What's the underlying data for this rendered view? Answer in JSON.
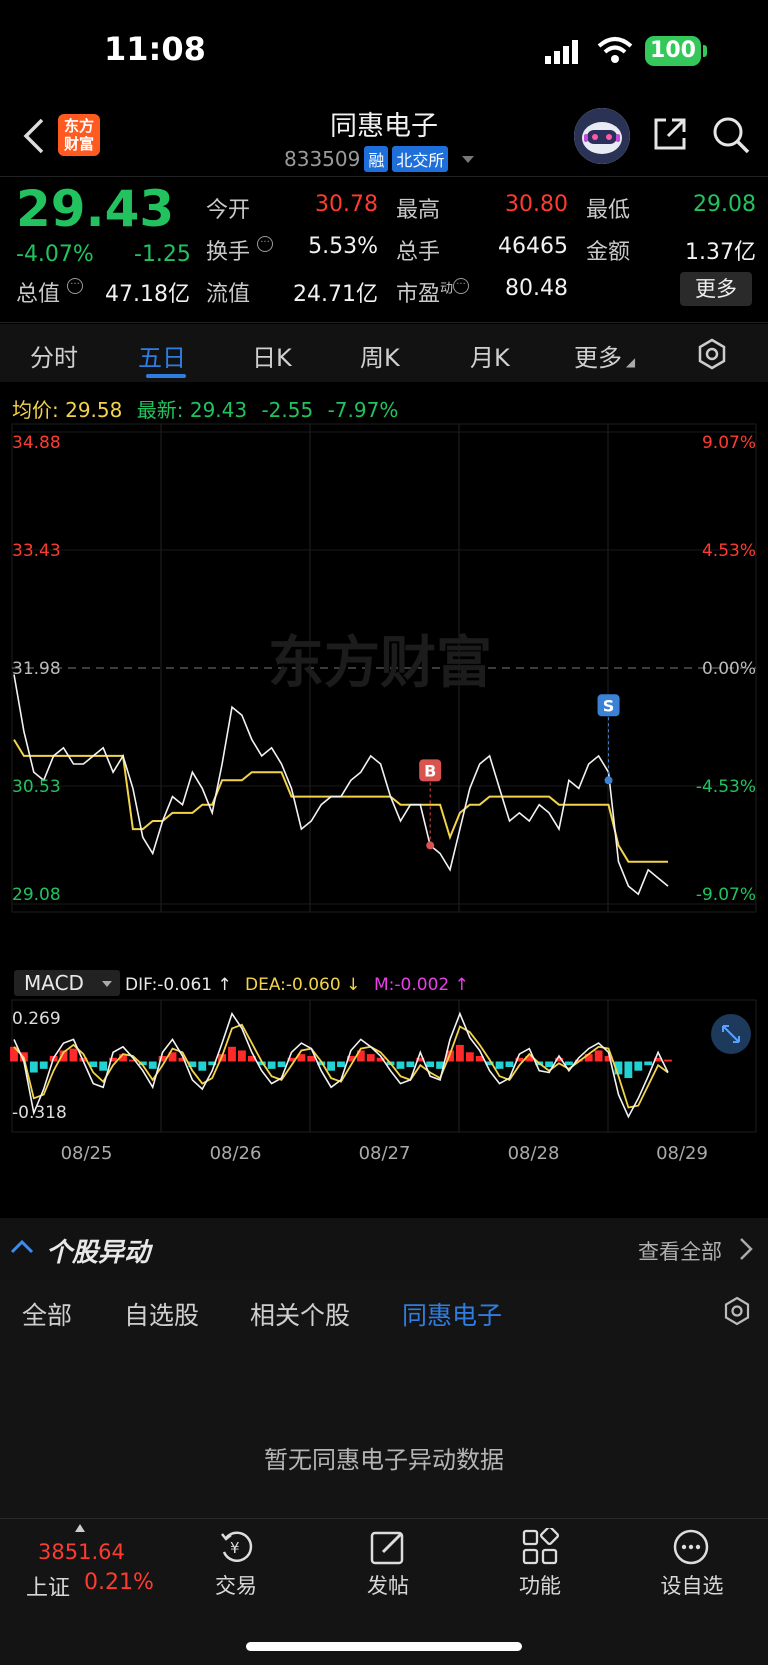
{
  "status": {
    "time": "11:08",
    "battery": "100"
  },
  "header": {
    "logo_line1": "东方",
    "logo_line2": "财富",
    "stock_name": "同惠电子",
    "stock_code": "833509",
    "tag_margin": "融",
    "tag_exchange": "北交所"
  },
  "quote": {
    "price": "29.43",
    "change_pct": "-4.07%",
    "change": "-1.25",
    "open_label": "今开",
    "open": "30.78",
    "high_label": "最高",
    "high": "30.80",
    "low_label": "最低",
    "low": "29.08",
    "turnover_label": "换手",
    "turnover": "5.53%",
    "volume_label": "总手",
    "volume": "46465",
    "amount_label": "金额",
    "amount": "1.37亿",
    "mktcap_label": "总值",
    "mktcap": "47.18亿",
    "float_label": "流值",
    "float_cap": "24.71亿",
    "pe_label": "市盈",
    "pe_super": "动",
    "pe": "80.48",
    "more_label": "更多"
  },
  "tabs": [
    {
      "label": "分时"
    },
    {
      "label": "五日"
    },
    {
      "label": "日K"
    },
    {
      "label": "周K"
    },
    {
      "label": "月K"
    },
    {
      "label": "更多"
    }
  ],
  "avgline": {
    "avg_label": "均价:",
    "avg": "29.58",
    "latest_label": "最新:",
    "latest": "29.43",
    "chg": "-2.55",
    "pct": "-7.97%"
  },
  "chart_data": {
    "type": "line",
    "price_axis_left": [
      "34.88",
      "33.43",
      "31.98",
      "30.53",
      "29.08"
    ],
    "price_axis_right": [
      "9.07%",
      "4.53%",
      "0.00%",
      "-4.53%",
      "-9.07%"
    ],
    "ylim": [
      29.08,
      34.88
    ],
    "reference_price": 31.98,
    "days": [
      "08/25",
      "08/26",
      "08/27",
      "08/28",
      "08/29"
    ],
    "series": [
      {
        "values": [
          31.9,
          31.2,
          30.7,
          30.6,
          30.9,
          31.0,
          30.8,
          30.8,
          30.9,
          31.0,
          30.7,
          30.9,
          30.5,
          29.9,
          29.7,
          30.1,
          30.4,
          30.3,
          30.7,
          30.5,
          30.2,
          30.8,
          31.5,
          31.4,
          31.1,
          30.9,
          31.0,
          30.8,
          30.5,
          30.0,
          30.1,
          30.3,
          30.4,
          30.4,
          30.6,
          30.7,
          30.9,
          30.8,
          30.4,
          30.1,
          30.3,
          30.3,
          29.8,
          29.7,
          29.5,
          30.0,
          30.5,
          30.8,
          30.9,
          30.5,
          30.1,
          30.2,
          30.1,
          30.3,
          30.2,
          30.0,
          30.6,
          30.5,
          30.8,
          30.9,
          30.7,
          29.6,
          29.3,
          29.2,
          29.5,
          29.4,
          29.3
        ]
      },
      {
        "values": [
          31.1,
          30.9,
          30.9,
          30.9,
          30.9,
          30.9,
          30.9,
          30.9,
          30.9,
          30.9,
          30.9,
          30.9,
          30.0,
          30.0,
          30.1,
          30.1,
          30.2,
          30.2,
          30.2,
          30.3,
          30.3,
          30.6,
          30.6,
          30.6,
          30.7,
          30.7,
          30.7,
          30.7,
          30.4,
          30.4,
          30.4,
          30.4,
          30.4,
          30.4,
          30.4,
          30.4,
          30.4,
          30.4,
          30.4,
          30.3,
          30.3,
          30.3,
          30.3,
          30.3,
          29.9,
          30.2,
          30.3,
          30.3,
          30.4,
          30.4,
          30.4,
          30.4,
          30.4,
          30.4,
          30.4,
          30.3,
          30.3,
          30.3,
          30.3,
          30.3,
          30.3,
          29.8,
          29.6,
          29.6,
          29.6,
          29.6,
          29.6
        ]
      }
    ],
    "markers": [
      {
        "label": "B",
        "x_index": 42,
        "value": 29.8
      },
      {
        "label": "S",
        "x_index": 60,
        "value": 30.6
      }
    ],
    "macd": {
      "label": "MACD",
      "dif_label": "DIF:",
      "dif": "-0.061 ↑",
      "dea_label": "DEA:",
      "dea": "-0.060 ↓",
      "m_label": "M:",
      "m": "-0.002 ↑",
      "axis_top": "0.269",
      "axis_bottom": "-0.318",
      "ylim": [
        -0.318,
        0.269
      ],
      "hist": [
        0.08,
        0.05,
        -0.06,
        -0.04,
        0.03,
        0.06,
        0.07,
        0.02,
        -0.03,
        -0.05,
        0.02,
        0.04,
        0.01,
        -0.02,
        -0.04,
        0.03,
        0.05,
        0.02,
        -0.03,
        -0.05,
        -0.02,
        0.04,
        0.08,
        0.06,
        0.03,
        -0.02,
        -0.04,
        -0.03,
        0.02,
        0.04,
        0.03,
        -0.02,
        -0.05,
        -0.03,
        0.03,
        0.06,
        0.04,
        0.02,
        -0.02,
        -0.04,
        -0.03,
        0.02,
        -0.03,
        -0.04,
        0.06,
        0.09,
        0.05,
        0.03,
        -0.02,
        -0.04,
        -0.03,
        0.02,
        0.03,
        -0.02,
        -0.03,
        0.02,
        -0.02,
        0.01,
        0.04,
        0.06,
        0.03,
        -0.07,
        -0.09,
        -0.05,
        -0.02,
        0.02,
        0.01
      ],
      "dif_values": [
        0.12,
        0.0,
        -0.28,
        -0.15,
        0.02,
        0.1,
        0.12,
        0.0,
        -0.12,
        -0.14,
        0.05,
        0.08,
        0.02,
        -0.05,
        -0.14,
        0.05,
        0.12,
        0.03,
        -0.1,
        -0.15,
        -0.05,
        0.1,
        0.26,
        0.18,
        0.05,
        -0.05,
        -0.12,
        -0.09,
        0.05,
        0.1,
        0.07,
        -0.05,
        -0.14,
        -0.1,
        0.06,
        0.12,
        0.08,
        0.03,
        -0.05,
        -0.12,
        -0.1,
        0.05,
        -0.08,
        -0.1,
        0.12,
        0.26,
        0.13,
        0.06,
        -0.05,
        -0.12,
        -0.09,
        0.04,
        0.07,
        -0.05,
        -0.06,
        0.03,
        -0.05,
        0.02,
        0.07,
        0.1,
        0.05,
        -0.18,
        -0.3,
        -0.2,
        -0.08,
        0.05,
        -0.06
      ],
      "dea_values": [
        0.08,
        0.02,
        -0.2,
        -0.18,
        -0.05,
        0.05,
        0.09,
        0.04,
        -0.06,
        -0.11,
        -0.02,
        0.04,
        0.03,
        -0.02,
        -0.1,
        -0.02,
        0.07,
        0.05,
        -0.05,
        -0.12,
        -0.09,
        0.03,
        0.18,
        0.2,
        0.1,
        0.0,
        -0.08,
        -0.1,
        -0.02,
        0.06,
        0.07,
        0.0,
        -0.09,
        -0.11,
        -0.02,
        0.07,
        0.08,
        0.05,
        -0.01,
        -0.08,
        -0.1,
        -0.02,
        -0.06,
        -0.09,
        0.04,
        0.19,
        0.16,
        0.09,
        0.01,
        -0.08,
        -0.1,
        -0.02,
        0.04,
        -0.01,
        -0.05,
        -0.01,
        -0.04,
        0.0,
        0.04,
        0.08,
        0.07,
        -0.08,
        -0.25,
        -0.24,
        -0.13,
        -0.02,
        -0.06
      ]
    }
  },
  "abnormal": {
    "title": "个股异动",
    "view_all": "查看全部",
    "filters": [
      {
        "label": "全部"
      },
      {
        "label": "自选股"
      },
      {
        "label": "相关个股"
      },
      {
        "label": "同惠电子"
      }
    ],
    "empty": "暂无同惠电子异动数据"
  },
  "bottom_nav": {
    "index_value": "3851.64",
    "index_name": "上证",
    "index_pct": "0.21%",
    "items": [
      {
        "label": "交易"
      },
      {
        "label": "发帖"
      },
      {
        "label": "功能"
      },
      {
        "label": "设自选"
      }
    ]
  },
  "colors": {
    "up": "#ff3b30",
    "down": "#22c35e",
    "accent": "#2f7de1",
    "avg_line": "#f2d34a",
    "hist_down": "#22d1d1"
  }
}
